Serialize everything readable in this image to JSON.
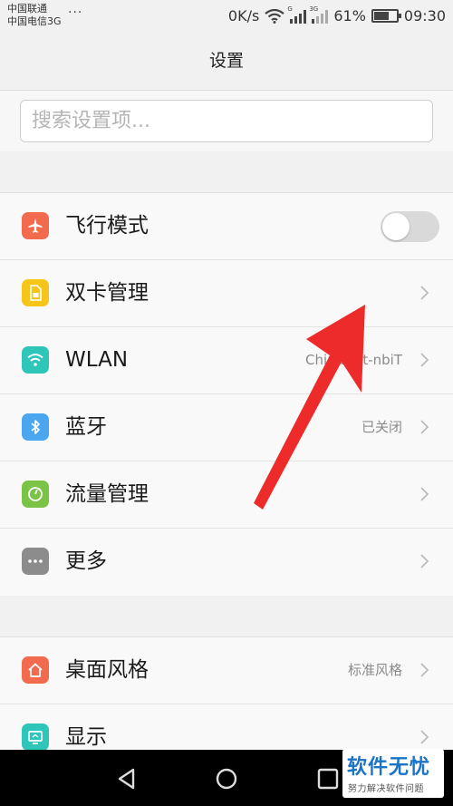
{
  "status_bar": {
    "carrier_1": "中国联通",
    "carrier_2": "中国电信3G",
    "more_dots": "···",
    "net_speed": "0K/s",
    "sig1_tag": "G",
    "sig2_tag": "3G",
    "battery_pct": "61%",
    "battery_level": 0.61,
    "time": "09:30"
  },
  "header": {
    "title": "设置"
  },
  "search": {
    "placeholder": "搜索设置项..."
  },
  "group1": [
    {
      "label": "飞行模式",
      "icon": "airplane-icon",
      "color": "#f26b4f",
      "toggle": true,
      "toggle_on": false
    },
    {
      "label": "双卡管理",
      "icon": "sim-card-icon",
      "color": "#f5c51a",
      "value": ""
    },
    {
      "label": "WLAN",
      "icon": "wifi-icon",
      "color": "#2dc6b8",
      "value": "ChinaNet-nbiT"
    },
    {
      "label": "蓝牙",
      "icon": "bluetooth-icon",
      "color": "#4aa6ef",
      "value": "已关闭"
    },
    {
      "label": "流量管理",
      "icon": "data-usage-icon",
      "color": "#7ac344",
      "value": ""
    },
    {
      "label": "更多",
      "icon": "more-icon",
      "color": "#8c8c8c",
      "value": ""
    }
  ],
  "group2": [
    {
      "label": "桌面风格",
      "icon": "home-icon",
      "color": "#f26b4f",
      "value": "标准风格"
    },
    {
      "label": "显示",
      "icon": "display-icon",
      "color": "#2dc6b8",
      "value": ""
    }
  ],
  "annotation": {
    "arrow_color": "#ee2b2b"
  },
  "watermark": {
    "title": "软件无忧",
    "subtitle": "努力解决软件问题"
  }
}
